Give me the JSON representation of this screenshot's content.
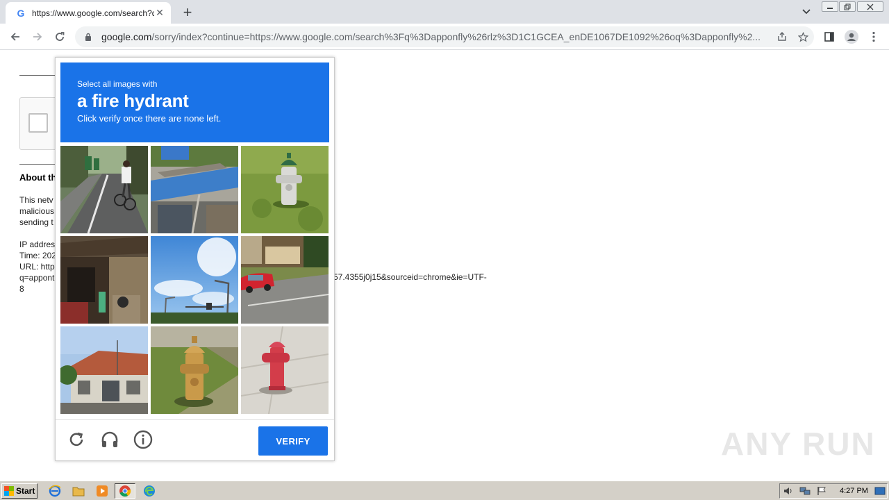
{
  "browser": {
    "tab_title": "https://www.google.com/search?q=",
    "tab_favicon": "G",
    "url_host": "google.com",
    "url_path": "/sorry/index?continue=https://www.google.com/search%3Fq%3Dapponfly%26rlz%3D1C1GCEA_enDE1067DE1092%26oq%3Dapponfly%2..."
  },
  "page": {
    "about_heading": "About th",
    "para1_line1": "This netv",
    "para1_line2": "malicious",
    "para1_line3": "sending t",
    "ip_line": "IP addres",
    "time_line": "Time: 202",
    "url_line": "URL: http",
    "q_line": "q=appont",
    "eight_line": "8",
    "tail_text": "57.4355j0j15&sourceid=chrome&ie=UTF-"
  },
  "captcha": {
    "instruction_small": "Select all images with",
    "target": "a fire hydrant",
    "instruction_sub": "Click verify once there are none left.",
    "verify_label": "VERIFY",
    "accent": "#1a73e8",
    "tiles": [
      {
        "name": "street-cyclist"
      },
      {
        "name": "tin-roof-shed"
      },
      {
        "name": "green-white-hydrant"
      },
      {
        "name": "storefront"
      },
      {
        "name": "sky-streetlight"
      },
      {
        "name": "red-car-road"
      },
      {
        "name": "house-roof"
      },
      {
        "name": "yellow-hydrant"
      },
      {
        "name": "red-hydrant"
      }
    ]
  },
  "watermark": "ANY RUN",
  "taskbar": {
    "start_label": "Start",
    "clock": "4:27 PM"
  }
}
